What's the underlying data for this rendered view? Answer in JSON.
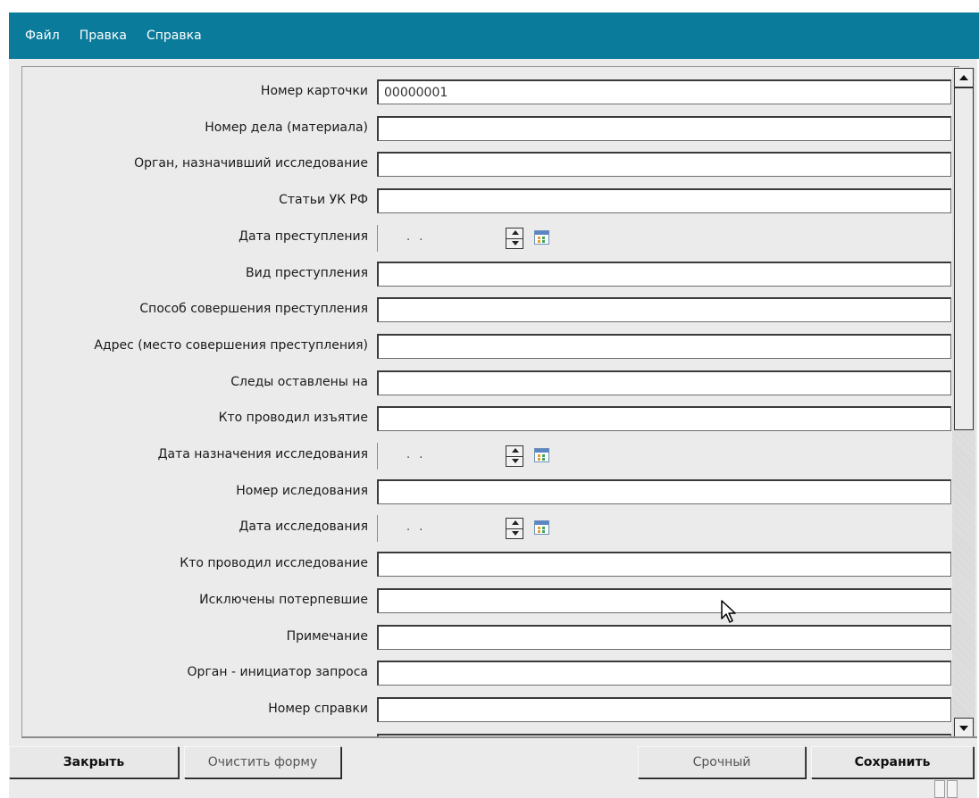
{
  "menu": {
    "file": "Файл",
    "edit": "Правка",
    "help": "Справка"
  },
  "fields": [
    {
      "label": "Номер карточки",
      "value": "00000001",
      "type": "text"
    },
    {
      "label": "Номер дела (материала)",
      "value": "",
      "type": "text"
    },
    {
      "label": "Орган, назначивший исследование",
      "value": "",
      "type": "text"
    },
    {
      "label": "Статьи УК РФ",
      "value": "",
      "type": "text"
    },
    {
      "label": "Дата преступления",
      "value": ". .",
      "type": "date"
    },
    {
      "label": "Вид преступления",
      "value": "",
      "type": "text"
    },
    {
      "label": "Способ совершения преступления",
      "value": "",
      "type": "text"
    },
    {
      "label": "Адрес (место совершения преступления)",
      "value": "",
      "type": "text"
    },
    {
      "label": "Следы оставлены на",
      "value": "",
      "type": "text"
    },
    {
      "label": "Кто проводил изъятие",
      "value": "",
      "type": "text"
    },
    {
      "label": "Дата назначения исследования",
      "value": ". .",
      "type": "date"
    },
    {
      "label": "Номер иследования",
      "value": "",
      "type": "text"
    },
    {
      "label": "Дата исследования",
      "value": ". .",
      "type": "date"
    },
    {
      "label": "Кто проводил исследование",
      "value": "",
      "type": "text"
    },
    {
      "label": "Исключены потерпевшие",
      "value": "",
      "type": "text"
    },
    {
      "label": "Примечание",
      "value": "",
      "type": "text"
    },
    {
      "label": "Орган - инициатор запроса",
      "value": "",
      "type": "text"
    },
    {
      "label": "Номер справки",
      "value": "",
      "type": "text"
    }
  ],
  "buttons": {
    "close": "Закрыть",
    "clear": "Очистить форму",
    "urgent": "Срочный",
    "save": "Сохранить"
  },
  "icons": {
    "calendar": "calendar-icon",
    "spinner": "spinner-icon",
    "scroll_up": "arrow-up-icon",
    "scroll_down": "arrow-down-icon",
    "cursor": "mouse-pointer-icon"
  },
  "colors": {
    "menubar": "#0a7b9a",
    "background": "#ebebeb"
  }
}
